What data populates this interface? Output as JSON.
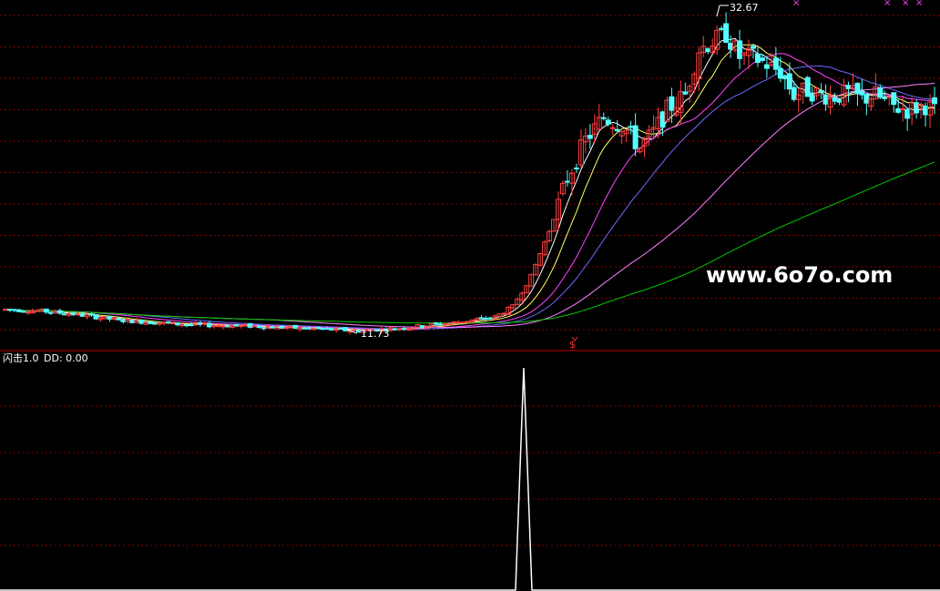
{
  "colors": {
    "background": "#000000",
    "grid": "#8a0000",
    "separator": "#c00000",
    "up_candle": "#ff4040",
    "down_candle": "#54ffff",
    "ma5": "#ffffff",
    "ma10": "#ffff66",
    "ma20": "#ff44ff",
    "ma30": "#6a6aff",
    "ma60": "#ff80ff",
    "ma120": "#00c800",
    "indicator_line": "#ffffff",
    "label_text": "#ffffff",
    "signal_marker": "#ff3030",
    "top_markers": "#ff44ff"
  },
  "price_panel": {
    "high_label": "32.67",
    "low_label": "11.73",
    "watermark": "www.6o7o.com",
    "signal_marker_label": "$",
    "top_marker_glyph": "×"
  },
  "indicator_panel": {
    "title": "闪击1.0",
    "value_label": "DD: 0.00"
  },
  "chart_data": [
    {
      "type": "candlestick",
      "title": "",
      "price_range": [
        11.73,
        32.67
      ],
      "y_axis_visible": false,
      "grid": true,
      "bar_count": 148,
      "annotations": [
        {
          "text": "32.67",
          "kind": "period-high"
        },
        {
          "text": "11.73",
          "kind": "period-low"
        }
      ],
      "moving_averages": [
        "#ffffff",
        "#ffff66",
        "#ff44ff",
        "#6a6aff",
        "#ff80ff",
        "#00c800"
      ]
    },
    {
      "type": "line",
      "title": "闪击1.0",
      "series": [
        {
          "name": "DD",
          "last_value": 0.0
        }
      ],
      "peak_value": 1,
      "grid": true
    }
  ]
}
